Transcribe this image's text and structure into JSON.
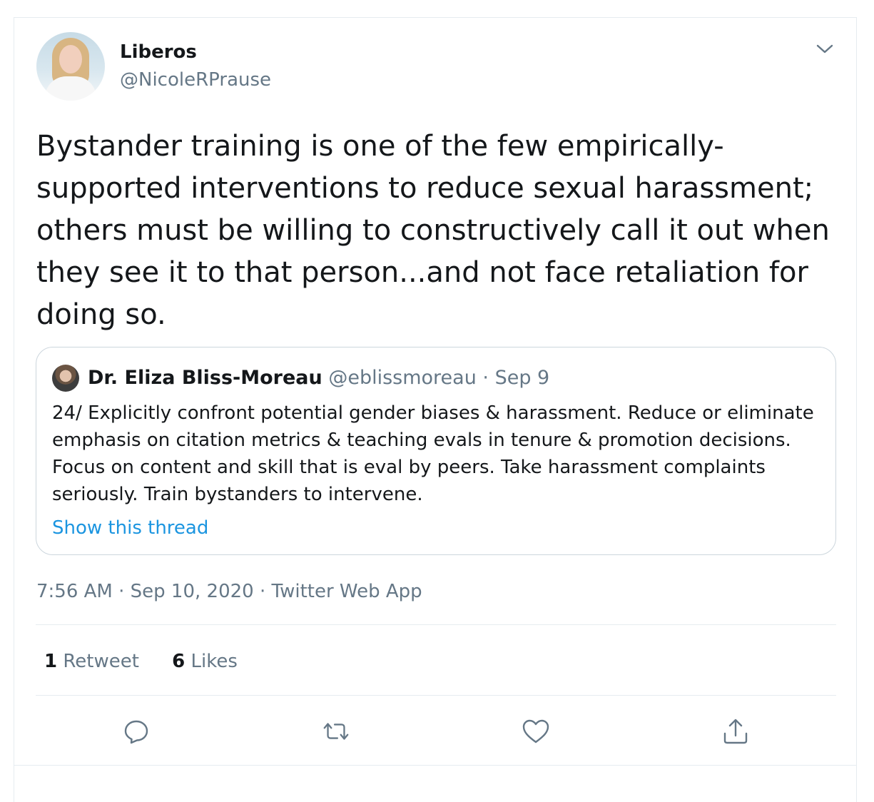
{
  "author": {
    "display_name": "Liberos",
    "handle": "@NicoleRPrause"
  },
  "tweet": {
    "text": "Bystander training is one of the few empirically-supported interventions to reduce sexual harassment; others must be willing to constructively call it out when they see it to that person...and not face retaliation for doing so.",
    "timestamp": "7:56 AM · Sep 10, 2020 · Twitter Web App"
  },
  "quoted_tweet": {
    "author_name": "Dr. Eliza Bliss-Moreau",
    "handle_and_date": "@eblissmoreau · Sep 9",
    "text": "24/ Explicitly confront potential gender biases & harassment.  Reduce or eliminate emphasis on citation metrics & teaching evals in tenure & promotion decisions. Focus on content and skill that is eval by peers. Take harassment complaints seriously. Train bystanders to intervene.",
    "show_thread_label": "Show this thread"
  },
  "stats": {
    "retweets_count": "1",
    "retweets_label": "Retweet",
    "likes_count": "6",
    "likes_label": "Likes"
  },
  "actions": {
    "icons": [
      "reply-icon",
      "retweet-icon",
      "like-icon",
      "share-icon"
    ]
  },
  "colors": {
    "text": "#14171a",
    "secondary": "#657786",
    "link": "#1b95e0",
    "border": "#e6ecf0"
  }
}
